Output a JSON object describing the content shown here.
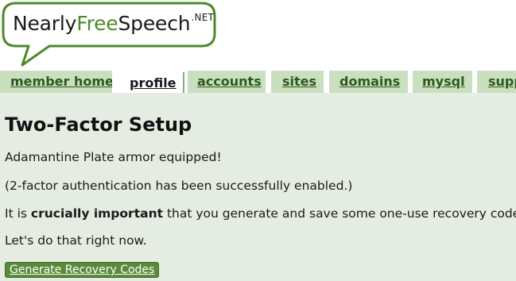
{
  "logo": {
    "part_nearly": "Nearly",
    "part_free": "Free",
    "part_speech": "Speech",
    "part_net": ".NET",
    "outline_color": "#4e8a2b"
  },
  "nav": {
    "tabs": [
      {
        "label": "member home",
        "active": false
      },
      {
        "label": "profile",
        "active": true
      },
      {
        "label": "accounts",
        "active": false
      },
      {
        "label": "sites",
        "active": false
      },
      {
        "label": "domains",
        "active": false
      },
      {
        "label": "mysql",
        "active": false
      },
      {
        "label": "supp",
        "active": false
      }
    ]
  },
  "main": {
    "title": "Two-Factor Setup",
    "line1": "Adamantine Plate armor equipped!",
    "line2": "(2-factor authentication has been successfully enabled.)",
    "line3_prefix": "It is ",
    "line3_bold": "crucially important",
    "line3_suffix": " that you generate and save some one-use recovery codes",
    "line4": "Let's do that right now.",
    "button_label": "Generate Recovery Codes"
  },
  "colors": {
    "tab_bg": "#c9dfc0",
    "content_bg": "#e5ece2",
    "link_green": "#2d5a1a",
    "button_bg": "#5a8a3c"
  }
}
